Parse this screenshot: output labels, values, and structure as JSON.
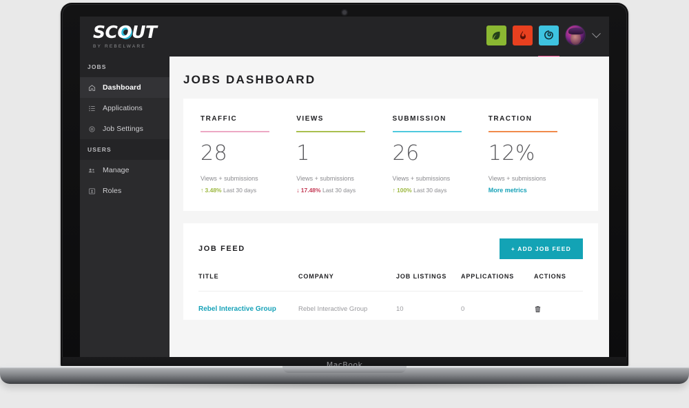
{
  "device": {
    "label": "MacBook"
  },
  "topbar": {
    "logo_text": "SCOUT",
    "logo_tagline": "BY REBELWARE",
    "apps": [
      {
        "name": "leaf-app-icon",
        "color": "#8bb832",
        "glyph": "leaf"
      },
      {
        "name": "flame-app-icon",
        "color": "#e8401f",
        "glyph": "flame"
      },
      {
        "name": "scout-app-icon",
        "color": "#3ec3e0",
        "glyph": "swirl",
        "active": true
      }
    ],
    "active_indicator_color": "#e84b8a",
    "avatar_name": "user-avatar"
  },
  "sidebar": {
    "sections": [
      {
        "label": "JOBS",
        "items": [
          {
            "label": "Dashboard",
            "icon": "home-icon",
            "active": true
          },
          {
            "label": "Applications",
            "icon": "list-icon",
            "active": false
          },
          {
            "label": "Job Settings",
            "icon": "gear-icon",
            "active": false
          }
        ]
      },
      {
        "label": "USERS",
        "items": [
          {
            "label": "Manage",
            "icon": "users-icon",
            "active": false
          },
          {
            "label": "Roles",
            "icon": "badge-icon",
            "active": false
          }
        ]
      }
    ]
  },
  "main": {
    "page_title": "JOBS DASHBOARD",
    "stats": [
      {
        "label": "TRAFFIC",
        "value": "28",
        "rule_color": "#eda8c4",
        "sub": "Views + submissions",
        "delta_dir": "up",
        "delta_arrow": "↑",
        "delta_value": "3.48%",
        "delta_color": "#9cb83f",
        "delta_period": "Last 30 days",
        "link": null
      },
      {
        "label": "VIEWS",
        "value": "1",
        "rule_color": "#a9bf4e",
        "sub": "Views + submissions",
        "delta_dir": "down",
        "delta_arrow": "↓",
        "delta_value": "17.48%",
        "delta_color": "#c43b56",
        "delta_period": "Last 30 days",
        "link": null
      },
      {
        "label": "SUBMISSION",
        "value": "26",
        "rule_color": "#4ec9de",
        "sub": "Views + submissions",
        "delta_dir": "up",
        "delta_arrow": "↑",
        "delta_value": "100%",
        "delta_color": "#9cb83f",
        "delta_period": "Last 30 days",
        "link": null
      },
      {
        "label": "TRACTION",
        "value": "12%",
        "rule_color": "#f08a4b",
        "sub": "Views + submissions",
        "delta_dir": null,
        "delta_arrow": "",
        "delta_value": "",
        "delta_color": "",
        "delta_period": "",
        "link": "More metrics"
      }
    ],
    "feed": {
      "title": "JOB FEED",
      "add_button": "+  ADD JOB FEED",
      "add_button_color": "#13a3b5",
      "columns": [
        "TITLE",
        "COMPANY",
        "JOB LISTINGS",
        "APPLICATIONS",
        "ACTIONS"
      ],
      "rows": [
        {
          "title": "Rebel Interactive Group",
          "company": "Rebel Interactive Group",
          "listings": "10",
          "applications": "0",
          "action": "delete-icon"
        }
      ]
    }
  }
}
